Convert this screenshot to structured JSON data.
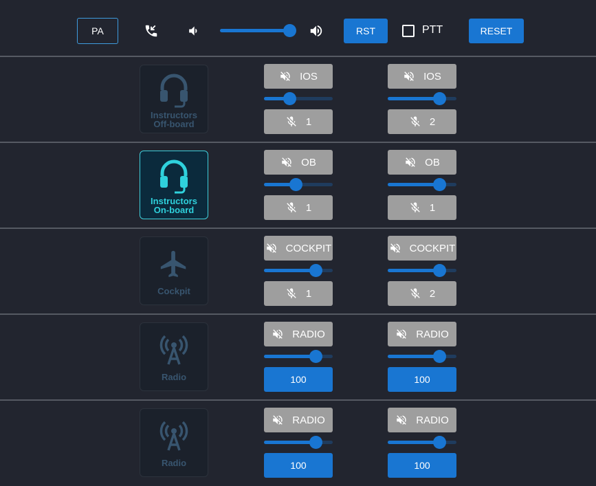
{
  "toolbar": {
    "pa_label": "PA",
    "call_icon": "call-received-icon",
    "volume_down_icon": "volume-down-icon",
    "volume_level": 0.92,
    "volume_up_icon": "volume-up-icon",
    "rst_label": "RST",
    "ptt_label": "PTT",
    "ptt_checked": false,
    "reset_label": "RESET"
  },
  "rows": [
    {
      "tile": {
        "icon": "headset-icon",
        "line1": "Instructors",
        "line2": "Off-board",
        "active": false
      },
      "channels": [
        {
          "mute_label": "IOS",
          "level": 0.37,
          "bottom_type": "mic",
          "bottom_label": "1"
        },
        {
          "mute_label": "IOS",
          "level": 0.75,
          "bottom_type": "mic",
          "bottom_label": "2"
        }
      ]
    },
    {
      "tile": {
        "icon": "headset-icon",
        "line1": "Instructors",
        "line2": "On-board",
        "active": true
      },
      "channels": [
        {
          "mute_label": "OB",
          "level": 0.46,
          "bottom_type": "mic",
          "bottom_label": "1"
        },
        {
          "mute_label": "OB",
          "level": 0.75,
          "bottom_type": "mic",
          "bottom_label": "1"
        }
      ]
    },
    {
      "tile": {
        "icon": "airplane-icon",
        "line1": "Cockpit",
        "line2": "",
        "active": false
      },
      "channels": [
        {
          "mute_label": "COCKPIT",
          "level": 0.75,
          "bottom_type": "mic",
          "bottom_label": "1"
        },
        {
          "mute_label": "COCKPIT",
          "level": 0.75,
          "bottom_type": "mic",
          "bottom_label": "2"
        }
      ]
    },
    {
      "tile": {
        "icon": "radio-tower-icon",
        "line1": "Radio",
        "line2": "",
        "active": false
      },
      "channels": [
        {
          "mute_label": "RADIO",
          "level": 0.75,
          "bottom_type": "value",
          "bottom_label": "100"
        },
        {
          "mute_label": "RADIO",
          "level": 0.75,
          "bottom_type": "value",
          "bottom_label": "100"
        }
      ]
    },
    {
      "tile": {
        "icon": "radio-tower-icon",
        "line1": "Radio",
        "line2": "",
        "active": false
      },
      "channels": [
        {
          "mute_label": "RADIO",
          "level": 0.75,
          "bottom_type": "value",
          "bottom_label": "100"
        },
        {
          "mute_label": "RADIO",
          "level": 0.75,
          "bottom_type": "value",
          "bottom_label": "100"
        }
      ]
    }
  ]
}
